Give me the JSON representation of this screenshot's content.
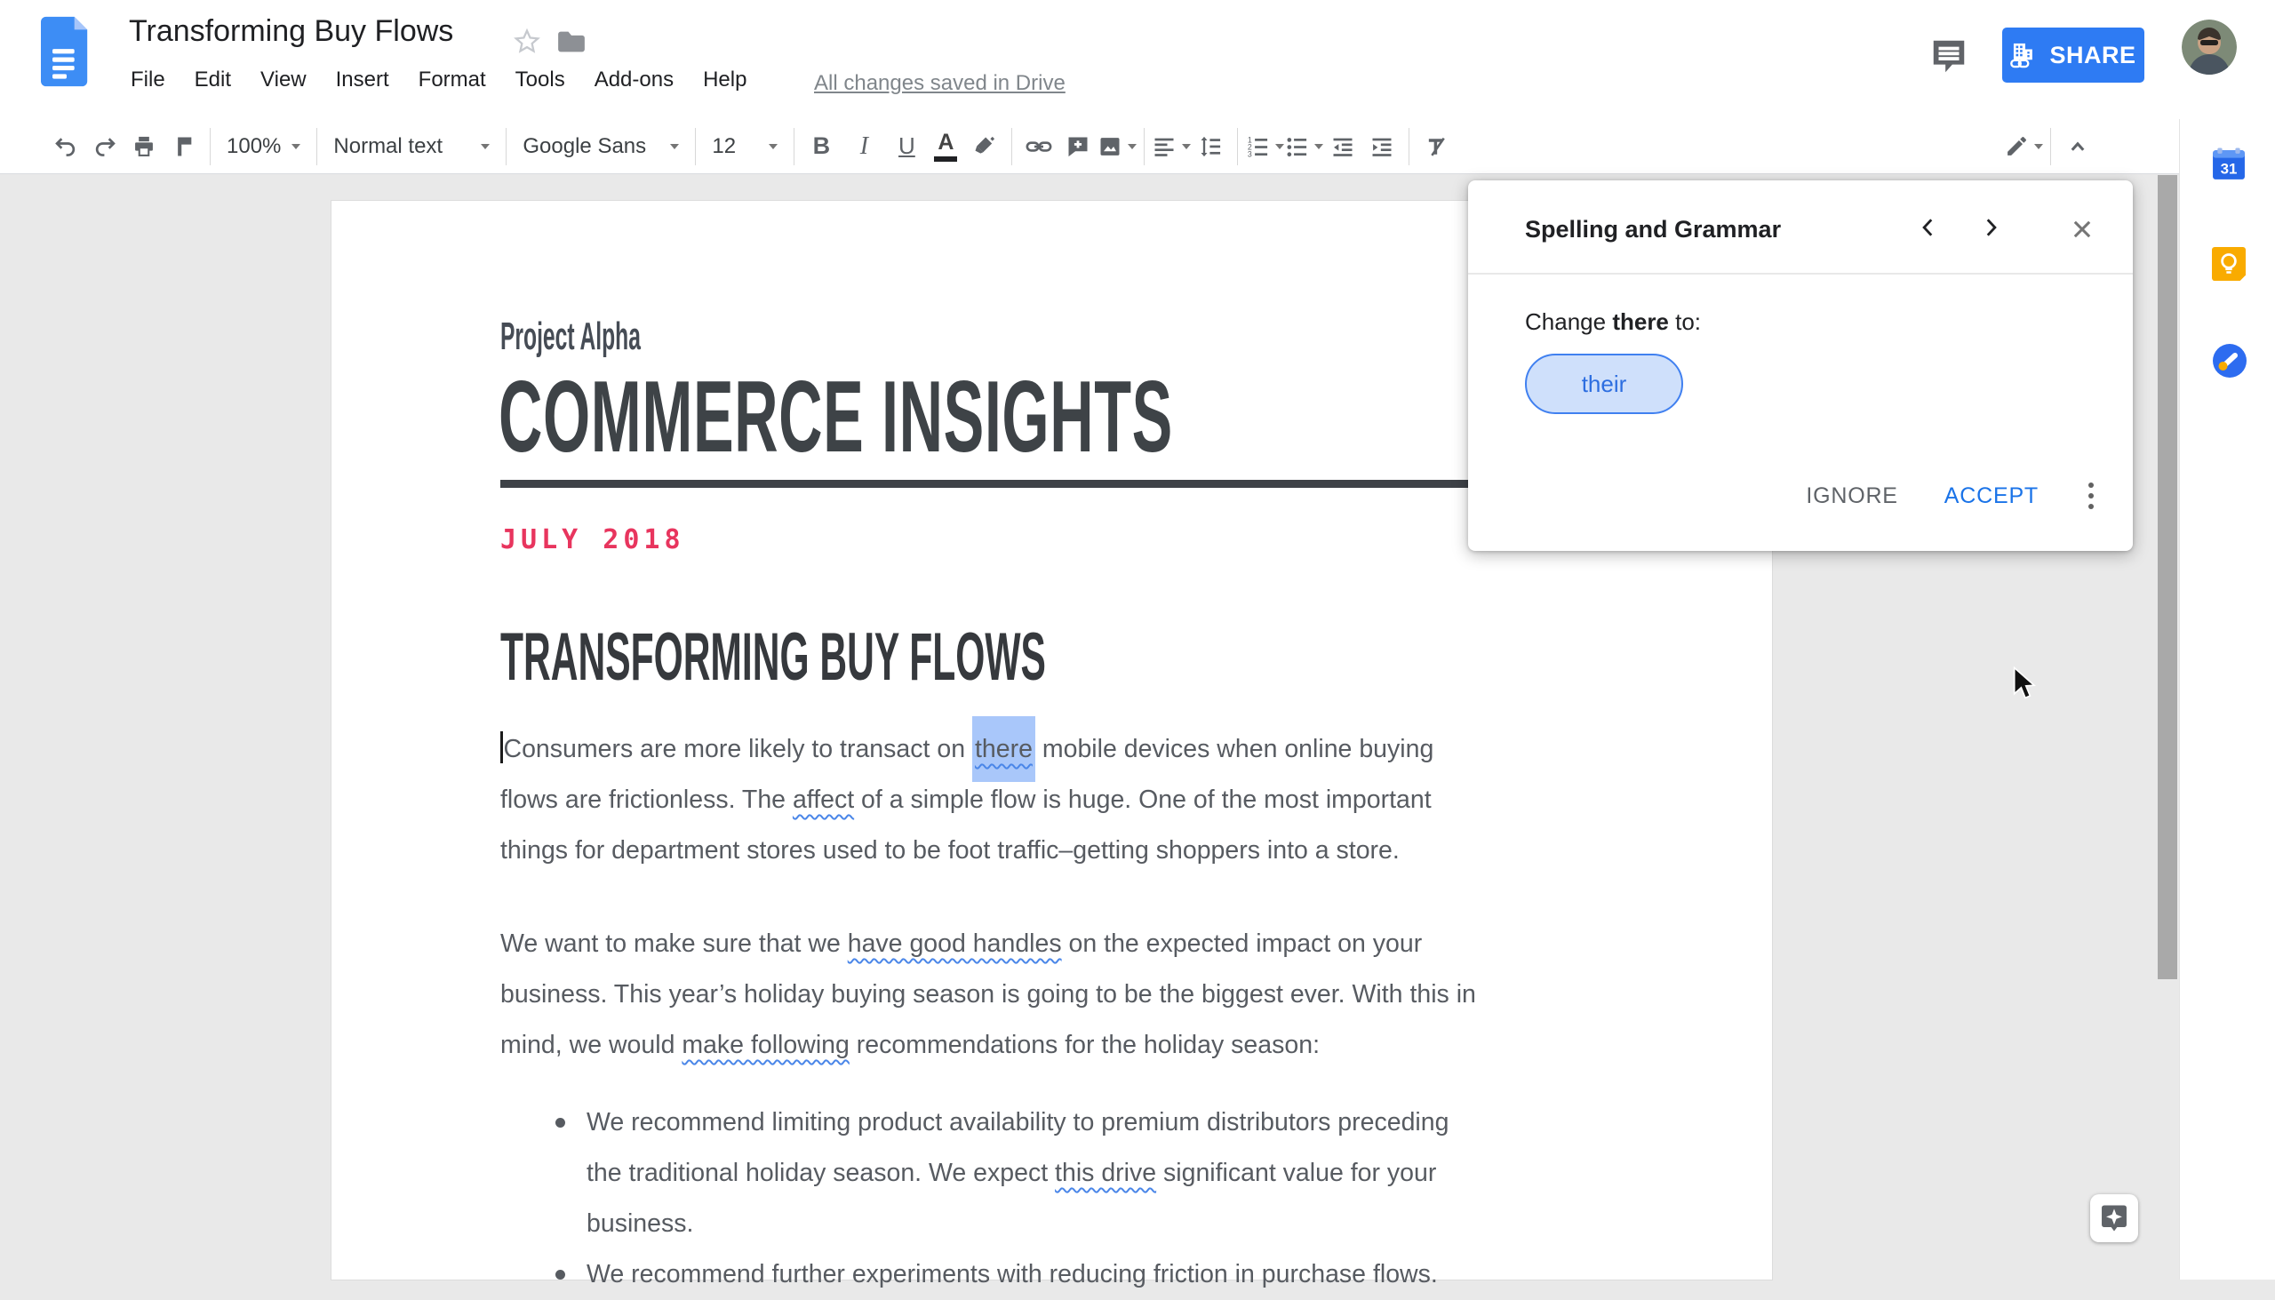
{
  "header": {
    "doc_title": "Transforming Buy Flows",
    "menus": [
      "File",
      "Edit",
      "View",
      "Insert",
      "Format",
      "Tools",
      "Add-ons",
      "Help"
    ],
    "saved_status": "All changes saved in Drive",
    "share_label": "SHARE"
  },
  "toolbar": {
    "zoom_value": "100%",
    "style_value": "Normal text",
    "font_value": "Google Sans",
    "size_value": "12",
    "bold": "B",
    "italic": "I",
    "underline": "U",
    "text_color": "A"
  },
  "dialog": {
    "title": "Spelling and Grammar",
    "change_prefix": "Change",
    "change_word": "there",
    "change_suffix": "to:",
    "suggestion": "their",
    "ignore_label": "IGNORE",
    "accept_label": "ACCEPT"
  },
  "doc": {
    "eyebrow": "Project Alpha",
    "title": "COMMERCE INSIGHTS",
    "date": "JULY 2018",
    "heading": "TRANSFORMING BUY FLOWS",
    "para1": [
      {
        "caret": true
      },
      {
        "t": "Consumers are more likely to transact on "
      },
      {
        "t": "there",
        "c": "sel sq"
      },
      {
        "t": " mobile devices when online buying",
        "br": true
      },
      {
        "t": "flows are frictionless. The "
      },
      {
        "t": "affect",
        "c": "sq"
      },
      {
        "t": " of a simple flow is huge. One of the most important",
        "br": true
      },
      {
        "t": "things for department stores used to be foot traffic–getting shoppers into a store."
      }
    ],
    "para2": [
      {
        "t": "We want to make sure that we "
      },
      {
        "t": "have good handles",
        "c": "sq"
      },
      {
        "t": " on the expected impact on your",
        "br": true
      },
      {
        "t": "business. This year’s holiday buying season is going to be the biggest ever. With this in",
        "br": true
      },
      {
        "t": "mind, we would "
      },
      {
        "t": "make following",
        "c": "sq"
      },
      {
        "t": " recommendations for the holiday season:"
      }
    ],
    "bullets": [
      {
        "segments": [
          {
            "t": "We recommend limiting product availability to premium distributors preceding",
            "br": true
          },
          {
            "t": "the traditional holiday season. We expect "
          },
          {
            "t": "this drive",
            "c": "sq"
          },
          {
            "t": " significant value for your",
            "br": true
          },
          {
            "t": "business."
          }
        ]
      },
      {
        "segments": [
          {
            "t": "We recommend further experiments with reducing friction in purchase flows."
          }
        ]
      }
    ]
  },
  "icons": {
    "docs-logo": "blue document",
    "star": "outline star",
    "folder": "move folder",
    "comment": "speech bubble",
    "share": "building with link",
    "undo": "↶",
    "redo": "↷",
    "print": "printer",
    "paint-format": "paint roller",
    "link": "chain",
    "insert-comment": "bubble plus",
    "insert-image": "picture",
    "align": "align-left lines",
    "line-spacing": "vertical arrows",
    "numbered-list": "123 list",
    "bulleted-list": "dot list",
    "outdent": "left arrow lines",
    "indent": "right arrow lines",
    "clear-format": "T slash",
    "edit-mode": "pencil",
    "collapse": "chevron up",
    "calendar": "31",
    "keep": "lightbulb",
    "tasks": "blue circle pencil",
    "explore": "four point star"
  },
  "colors": {
    "accent_blue": "#2e7bf3",
    "accept_blue": "#1a73e8",
    "suggestion_fill": "#cfe0fb",
    "suggestion_border": "#4080f0",
    "date_pink": "#e8355e",
    "selection": "#a9c7fa",
    "squiggle": "#4a86e8",
    "canvas_gray": "#e9e9e9"
  }
}
